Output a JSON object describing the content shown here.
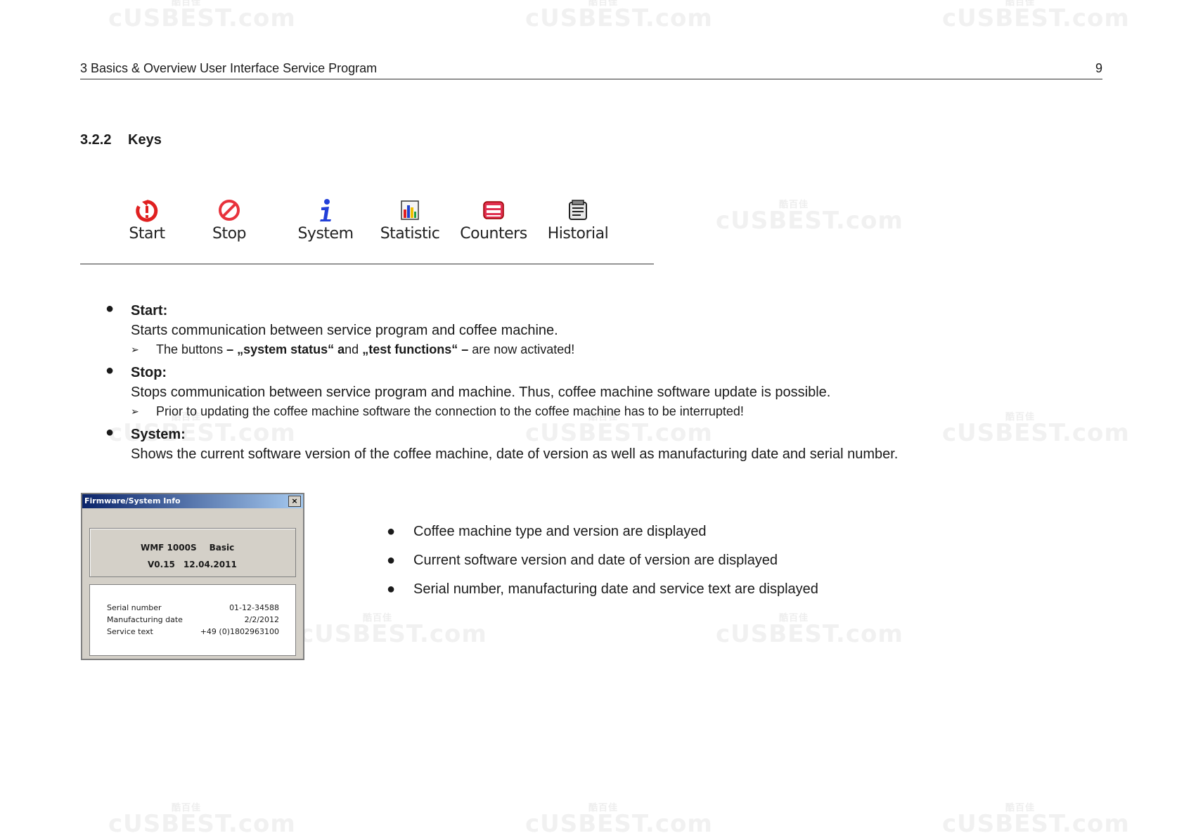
{
  "header": {
    "title": "3 Basics & Overview User Interface Service Program",
    "page_number": "9"
  },
  "section": {
    "number": "3.2.2",
    "title": "Keys"
  },
  "toolbar": {
    "keys": [
      {
        "label": "Start",
        "icon": "start-icon"
      },
      {
        "label": "Stop",
        "icon": "stop-icon"
      },
      {
        "label": "System",
        "icon": "info-icon"
      },
      {
        "label": "Statistic",
        "icon": "statistic-chart-icon"
      },
      {
        "label": "Counters",
        "icon": "counters-icon"
      },
      {
        "label": "Historial",
        "icon": "historial-icon"
      }
    ]
  },
  "descriptions": [
    {
      "heading": "Start:",
      "text": "Starts communication between service program and coffee machine.",
      "note": {
        "p1": "The buttons ",
        "b1": "– „system status“ a",
        "p2": "nd ",
        "b2": "„test functions“ –",
        "p3": " are now activated!"
      }
    },
    {
      "heading": "Stop:",
      "text": "Stops communication between service program and machine. Thus, coffee machine software update is possible.",
      "note_text": "Prior to updating the coffee machine software the connection to the coffee machine has to be interrupted!"
    },
    {
      "heading": "System:",
      "text": "Shows the current software version of the coffee machine, date of version as well as manufacturing date and serial number."
    }
  ],
  "dialog": {
    "title": "Firmware/System Info",
    "close": "×",
    "model": "WMF 1000S",
    "variant": "Basic",
    "version": "V0.15",
    "version_date": "12.04.2011",
    "rows": [
      {
        "key": "Serial number",
        "value": "01-12-34588"
      },
      {
        "key": "Manufacturing date",
        "value": "2/2/2012"
      },
      {
        "key": "Service text",
        "value": "+49 (0)1802963100"
      }
    ]
  },
  "bullets": [
    "Coffee machine type and version are displayed",
    "Current software version and date of version are displayed",
    "Serial number, manufacturing date and service text are displayed"
  ],
  "bullet_symbol": "●",
  "watermark": {
    "text": "cUSBEST.com",
    "small": "酷百佳"
  },
  "colors": {
    "start_red": "#e02020",
    "stop_red": "#e8323c",
    "system_blue": "#2340d8",
    "counters_red": "#e03050"
  }
}
